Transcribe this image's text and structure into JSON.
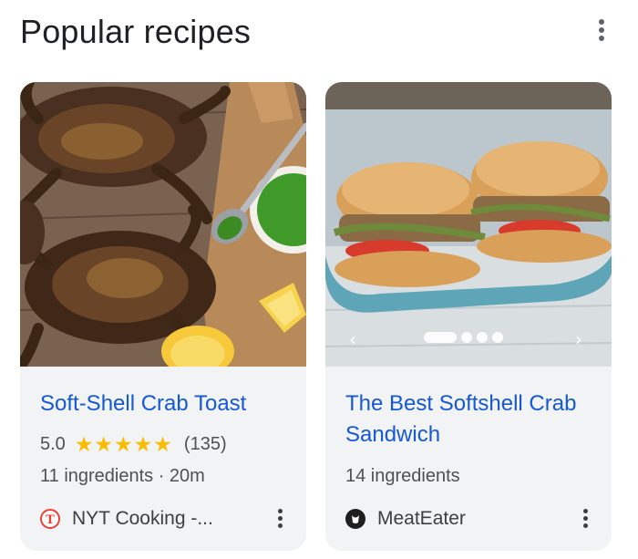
{
  "header": {
    "title": "Popular recipes",
    "menu_icon": "more-vert-icon"
  },
  "cards": [
    {
      "title": "Soft-Shell Crab Toast",
      "rating": "5.0",
      "stars": "★★★★★",
      "rating_count": "(135)",
      "details": "11 ingredients · 20m",
      "source": "NYT Cooking -...",
      "source_icon": "nyt-logo-icon",
      "source_icon_glyph": "𝕿",
      "image": "soft-shell-crabs-on-cutting-board"
    },
    {
      "title": "The Best Softshell Crab Sandwich",
      "details": "14 ingredients",
      "source": "MeatEater",
      "source_icon": "meateater-logo-icon",
      "image": "softshell-crab-sandwiches-on-platter",
      "carousel": {
        "prev": "‹",
        "next": "›",
        "total": 4,
        "active": 1
      }
    }
  ],
  "colors": {
    "link": "#1558d6",
    "star": "#fbbc04",
    "card_bg": "#f1f3f4",
    "nyt_red": "#e94235"
  }
}
